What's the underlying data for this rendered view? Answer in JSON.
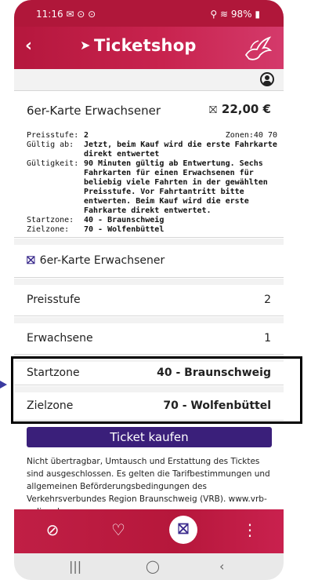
{
  "status": {
    "time": "11:16",
    "notif_icons": "✉ ⊙ ⊙",
    "battery": "98%"
  },
  "appbar": {
    "title": "Ticketshop"
  },
  "ticket": {
    "name": "6er-Karte Erwachsener",
    "price": "22,00 €",
    "info": [
      {
        "k": "Preisstufe:",
        "v": "2"
      },
      {
        "k": "Gültig ab:",
        "v": "Jetzt, beim Kauf wird die erste Fahrkarte direkt entwertet"
      },
      {
        "k": "Gültigkeit:",
        "v": "90 Minuten gültig ab Entwertung. Sechs Fahrkarten für einen Erwachsenen für beliebig viele Fahrten in der gewählten Preisstufe. Vor Fahrtantritt bitte entwerten. Beim Kauf wird die erste Fahrkarte direkt entwertet."
      },
      {
        "k": "Startzone:",
        "v": "40 - Braunschweig"
      },
      {
        "k": "Zielzone:",
        "v": "70 - Wolfenbüttel"
      }
    ],
    "zones": "Zonen:40 70"
  },
  "selection": {
    "ticket_label": "6er-Karte Erwachsener",
    "preisstufe_label": "Preisstufe",
    "preisstufe_value": "2",
    "erwachsene_label": "Erwachsene",
    "erwachsene_value": "1",
    "startzone_label": "Startzone",
    "startzone_value": "40 - Braunschweig",
    "zielzone_label": "Zielzone",
    "zielzone_value": "70 - Wolfenbüttel"
  },
  "buy_button": "Ticket kaufen",
  "legal": "Nicht übertragbar, Umtausch und Erstattung des Ticktes sind ausgeschlossen. Es gelten die Tarifbestimmungen und allgemeinen Beförderungsbedingungen des Verkehrsverbundes Region Braunschweig (VRB). www.vrb-online.de",
  "colors": {
    "brand": "#b5173d",
    "button": "#3a1f7a"
  }
}
